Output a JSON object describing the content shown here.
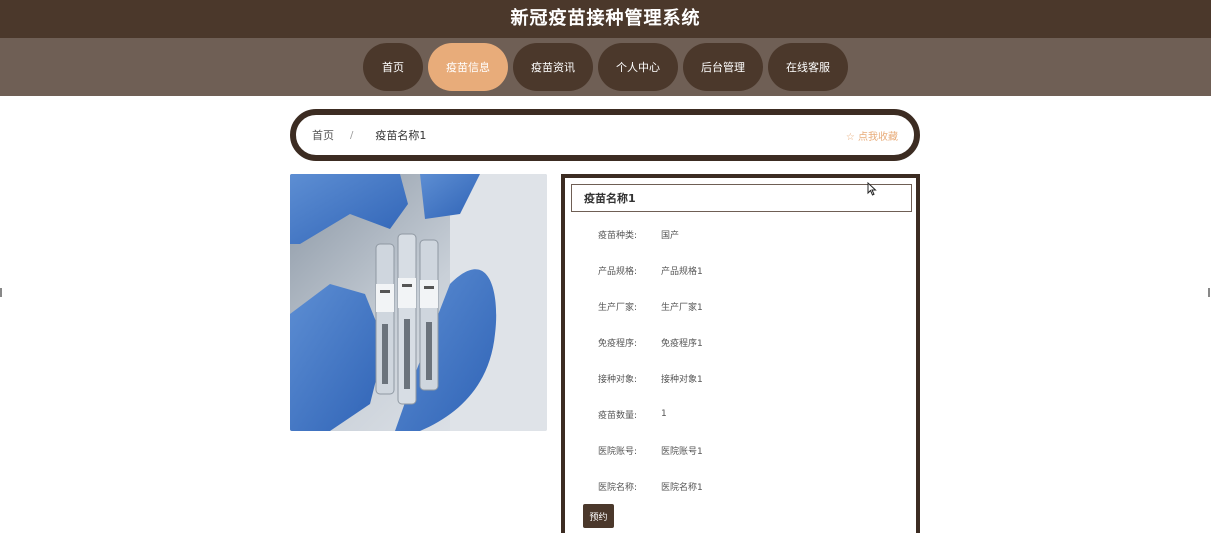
{
  "site": {
    "title": "新冠疫苗接种管理系统"
  },
  "nav": {
    "items": [
      {
        "label": "首页"
      },
      {
        "label": "疫苗信息"
      },
      {
        "label": "疫苗资讯"
      },
      {
        "label": "个人中心"
      },
      {
        "label": "后台管理"
      },
      {
        "label": "在线客服"
      }
    ],
    "active_index": 1
  },
  "breadcrumb": {
    "home": "首页",
    "separator": "/",
    "current": "疫苗名称1",
    "favorite": "☆ 点我收藏"
  },
  "detail": {
    "title": "疫苗名称1",
    "fields": [
      {
        "label": "疫苗种类:",
        "value": "国产"
      },
      {
        "label": "产品规格:",
        "value": "产品规格1"
      },
      {
        "label": "生产厂家:",
        "value": "生产厂家1"
      },
      {
        "label": "免疫程序:",
        "value": "免疫程序1"
      },
      {
        "label": "接种对象:",
        "value": "接种对象1"
      },
      {
        "label": "疫苗数量:",
        "value": "1"
      },
      {
        "label": "医院账号:",
        "value": "医院账号1"
      },
      {
        "label": "医院名称:",
        "value": "医院名称1"
      }
    ],
    "reserve_label": "预约"
  },
  "colors": {
    "header_dark": "#4b382b",
    "nav_bg": "#6f5f55",
    "accent": "#e8ac7a"
  }
}
